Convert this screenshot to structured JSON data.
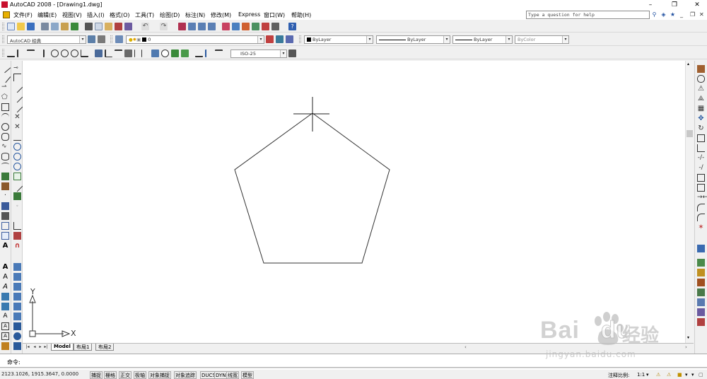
{
  "window": {
    "title": "AutoCAD 2008 - [Drawing1.dwg]",
    "controls": [
      "–",
      "❐",
      "✕"
    ]
  },
  "menu": {
    "items": [
      "文件(F)",
      "编辑(E)",
      "视图(V)",
      "插入(I)",
      "格式(O)",
      "工具(T)",
      "绘图(D)",
      "标注(N)",
      "修改(M)",
      "Express",
      "窗口(W)",
      "帮助(H)"
    ],
    "help_search_placeholder": "Type a question for help",
    "doc_controls": [
      "_",
      "❐",
      "✕"
    ]
  },
  "toolbars": {
    "workspace": "AutoCAD 经典",
    "layer_name": "0",
    "color": "ByLayer",
    "linetype": "ByLayer",
    "lineweight": "ByLayer",
    "plotstyle": "ByColor",
    "dimstyle": "ISO-25"
  },
  "canvas": {
    "ucs_x_label": "X",
    "ucs_y_label": "Y",
    "crosshair": true,
    "shape": "pentagon"
  },
  "layout_tabs": {
    "tabs": [
      "Model",
      "布局1",
      "布局2"
    ],
    "active": "Model"
  },
  "command": {
    "prompt": "命令:"
  },
  "status": {
    "coords": "2123.1026, 1915.3647, 0.0000",
    "toggles": [
      "捕捉",
      "栅格",
      "正交",
      "极轴",
      "对象捕捉",
      "对象追踪",
      "DUCS",
      "DYN",
      "线宽",
      "模型"
    ],
    "annotation_scale_label": "注释比例:",
    "annotation_scale": "1:1"
  },
  "watermark": {
    "brand": "Bai",
    "brand_suffix": "du",
    "chinese": "经验",
    "url": "jingyan.baidu.com"
  }
}
